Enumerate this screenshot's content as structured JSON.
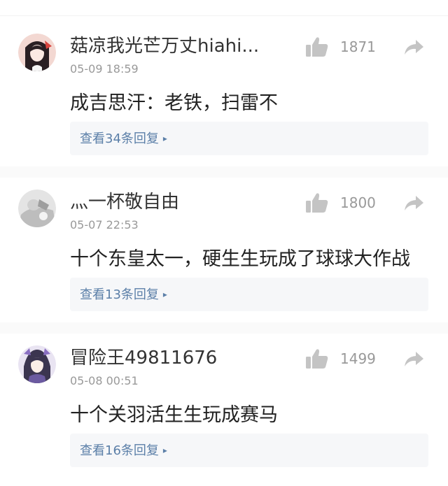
{
  "comments": [
    {
      "user": "菇凉我光芒万丈hiahi...",
      "time": "05-09 18:59",
      "likes": "1871",
      "text": "成吉思汗：老铁，扫雷不",
      "replies": "查看34条回复"
    },
    {
      "user": "灬一杯敬自由",
      "time": "05-07 22:53",
      "likes": "1800",
      "text": "十个东皇太一，硬生生玩成了球球大作战",
      "replies": "查看13条回复"
    },
    {
      "user": "冒险王49811676",
      "time": "05-08 00:51",
      "likes": "1499",
      "text": "十个关羽活生生玩成赛马",
      "replies": "查看16条回复"
    }
  ],
  "icons": {
    "like": "thumbs-up-icon",
    "share": "share-arrow-icon",
    "replies_chevron": "chevron-right-icon"
  },
  "colors": {
    "icon_gray": "#c4c4c4",
    "link_blue": "#5b7fa8",
    "reply_bg": "#f6f7f9",
    "meta_gray": "#999999"
  }
}
